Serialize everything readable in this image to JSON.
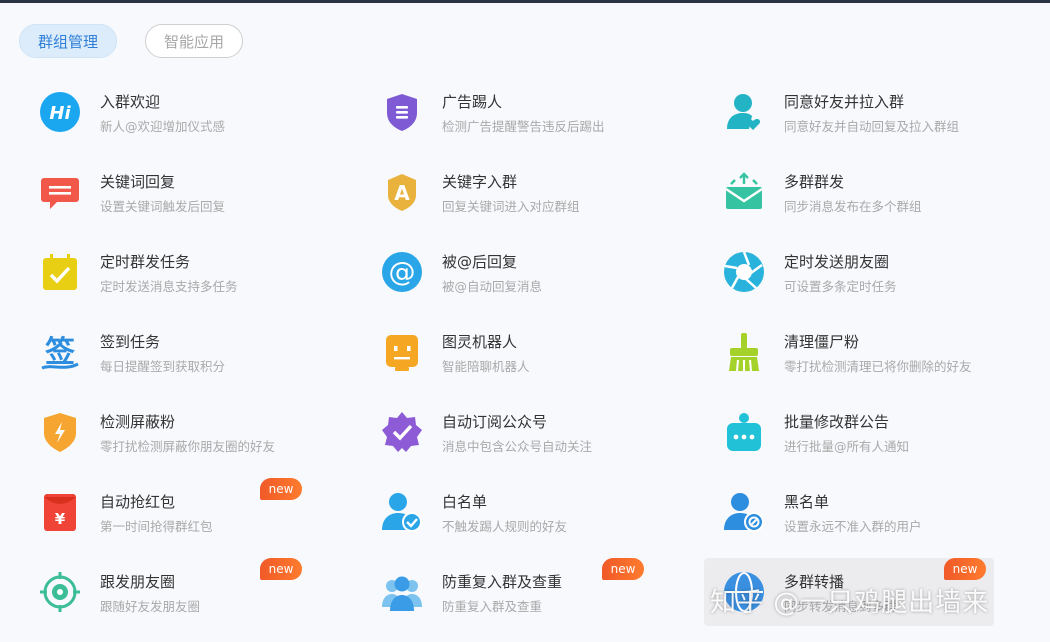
{
  "tabs": [
    {
      "label": "群组管理",
      "active": true
    },
    {
      "label": "智能应用",
      "active": false
    }
  ],
  "items": [
    {
      "title": "入群欢迎",
      "desc": "新人@欢迎增加仪式感",
      "icon": "hi-icon"
    },
    {
      "title": "广告踢人",
      "desc": "检测广告提醒警告违反后踢出",
      "icon": "shield-list-icon"
    },
    {
      "title": "同意好友并拉入群",
      "desc": "同意好友并自动回复及拉入群组",
      "icon": "user-heart-icon"
    },
    {
      "title": "关键词回复",
      "desc": "设置关键词触发后回复",
      "icon": "chat-bubble-icon"
    },
    {
      "title": "关键字入群",
      "desc": "回复关键词进入对应群组",
      "icon": "letter-a-badge-icon"
    },
    {
      "title": "多群群发",
      "desc": "同步消息发布在多个群组",
      "icon": "mail-broadcast-icon"
    },
    {
      "title": "定时群发任务",
      "desc": "定时发送消息支持多任务",
      "icon": "calendar-check-icon"
    },
    {
      "title": "被@后回复",
      "desc": "被@自动回复消息",
      "icon": "at-sign-icon"
    },
    {
      "title": "定时发送朋友圈",
      "desc": "可设置多条定时任务",
      "icon": "aperture-icon"
    },
    {
      "title": "签到任务",
      "desc": "每日提醒签到获取积分",
      "icon": "signature-icon"
    },
    {
      "title": "图灵机器人",
      "desc": "智能陪聊机器人",
      "icon": "robot-icon"
    },
    {
      "title": "清理僵尸粉",
      "desc": "零打扰检测清理已将你删除的好友",
      "icon": "broom-icon"
    },
    {
      "title": "检测屏蔽粉",
      "desc": "零打扰检测屏蔽你朋友圈的好友",
      "icon": "shield-bolt-icon"
    },
    {
      "title": "自动订阅公众号",
      "desc": "消息中包含公众号自动关注",
      "icon": "star-badge-check-icon"
    },
    {
      "title": "批量修改群公告",
      "desc": "进行批量@所有人通知",
      "icon": "notice-bag-icon"
    },
    {
      "title": "自动抢红包",
      "desc": "第一时间抢得群红包",
      "icon": "red-packet-icon",
      "badge": "new"
    },
    {
      "title": "白名单",
      "desc": "不触发踢人规则的好友",
      "icon": "user-check-icon"
    },
    {
      "title": "黑名单",
      "desc": "设置永远不准入群的用户",
      "icon": "user-block-icon"
    },
    {
      "title": "跟发朋友圈",
      "desc": "跟随好友发朋友圈",
      "icon": "target-aperture-icon",
      "badge": "new"
    },
    {
      "title": "防重复入群及查重",
      "desc": "防重复入群及查重",
      "icon": "users-group-icon",
      "badge": "new"
    },
    {
      "title": "多群转播",
      "desc": "同步转发消息到多群",
      "icon": "globe-icon",
      "badge": "new"
    }
  ],
  "watermark": "知乎 @一只鸡腿出墙来",
  "colors": {
    "accent": "#2f7fd6",
    "badge": "#f05a28"
  }
}
